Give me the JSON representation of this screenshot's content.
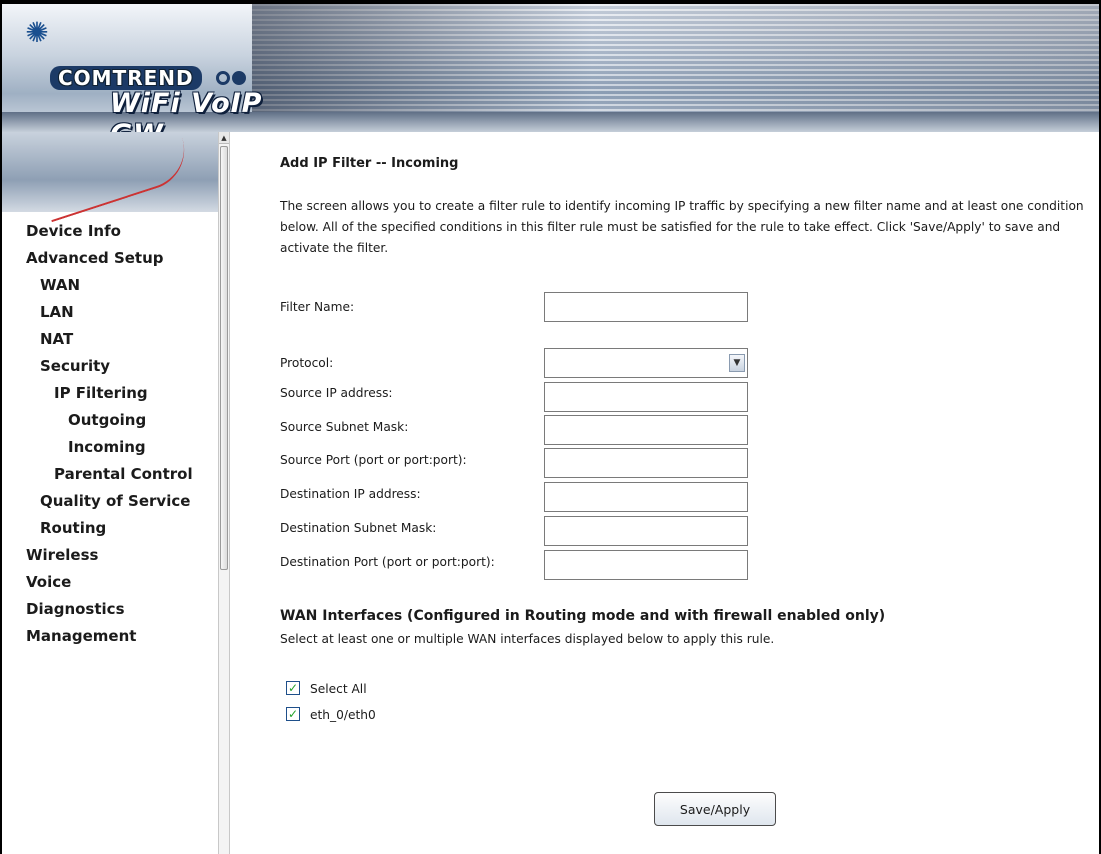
{
  "header": {
    "brand": "COMTREND",
    "product": "WiFi VoIP GW"
  },
  "sidebar": {
    "items": [
      {
        "label": "Device Info",
        "level": 0
      },
      {
        "label": "Advanced Setup",
        "level": 0
      },
      {
        "label": "WAN",
        "level": 1
      },
      {
        "label": "LAN",
        "level": 1
      },
      {
        "label": "NAT",
        "level": 1
      },
      {
        "label": "Security",
        "level": 1
      },
      {
        "label": "IP Filtering",
        "level": 2
      },
      {
        "label": "Outgoing",
        "level": 3
      },
      {
        "label": "Incoming",
        "level": 3
      },
      {
        "label": "Parental Control",
        "level": 2
      },
      {
        "label": "Quality of Service",
        "level": 1
      },
      {
        "label": "Routing",
        "level": 1
      },
      {
        "label": "Wireless",
        "level": 0
      },
      {
        "label": "Voice",
        "level": 0
      },
      {
        "label": "Diagnostics",
        "level": 0
      },
      {
        "label": "Management",
        "level": 0
      }
    ]
  },
  "main": {
    "title": "Add IP Filter -- Incoming",
    "description": "The screen allows you to create a filter rule to identify incoming IP traffic by specifying a new filter name and at least one condition below. All of the specified conditions in this filter rule must be satisfied for the rule to take effect. Click 'Save/Apply' to save and activate the filter.",
    "fields": {
      "filter_name": {
        "label": "Filter Name:",
        "value": ""
      },
      "protocol": {
        "label": "Protocol:",
        "value": ""
      },
      "source_ip": {
        "label": "Source IP address:",
        "value": ""
      },
      "source_mask": {
        "label": "Source Subnet Mask:",
        "value": ""
      },
      "source_port": {
        "label": "Source Port (port or port:port):",
        "value": ""
      },
      "dest_ip": {
        "label": "Destination IP address:",
        "value": ""
      },
      "dest_mask": {
        "label": "Destination Subnet Mask:",
        "value": ""
      },
      "dest_port": {
        "label": "Destination Port (port or port:port):",
        "value": ""
      }
    },
    "wan": {
      "title": "WAN Interfaces (Configured in Routing mode and with firewall enabled only)",
      "description": "Select at least one or multiple WAN interfaces displayed below to apply this rule.",
      "select_all_label": "Select All",
      "select_all_checked": true,
      "interfaces": [
        {
          "label": "eth_0/eth0",
          "checked": true
        }
      ]
    },
    "save_label": "Save/Apply"
  },
  "colors": {
    "text": "#1b1b1b",
    "checkmark": "#22a12a",
    "header_dark": "#1c3a66"
  }
}
